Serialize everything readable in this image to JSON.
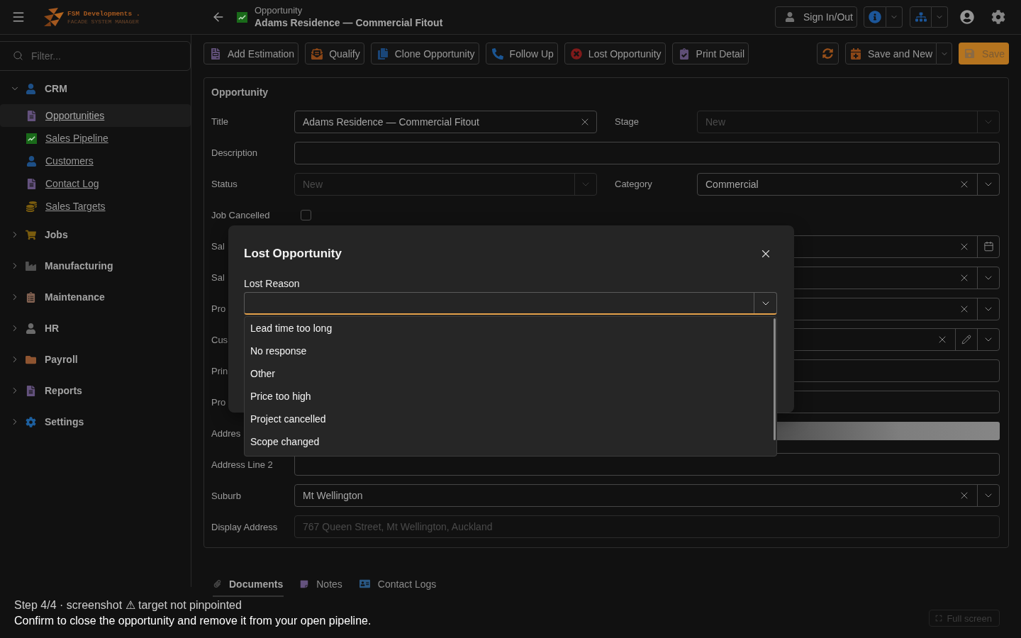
{
  "header": {
    "logo_text": "FSM Developments .",
    "logo_tagline": "FACADE SYSTEM MANAGER",
    "breadcrumb": "Opportunity",
    "title": "Adams Residence — Commercial Fitout",
    "sign_in_button": "Sign In/Out"
  },
  "sidebar": {
    "filter": {
      "placeholder": "Filter..."
    },
    "items": [
      {
        "label": "CRM",
        "expanded": true,
        "children": [
          {
            "label": "Opportunities",
            "selected": true
          },
          {
            "label": "Sales Pipeline",
            "selected": false
          },
          {
            "label": "Customers",
            "selected": false
          },
          {
            "label": "Contact Log",
            "selected": false
          },
          {
            "label": "Sales Targets",
            "selected": false
          }
        ]
      },
      {
        "label": "Jobs",
        "expanded": false
      },
      {
        "label": "Manufacturing",
        "expanded": false
      },
      {
        "label": "Maintenance",
        "expanded": false
      },
      {
        "label": "HR",
        "expanded": false
      },
      {
        "label": "Payroll",
        "expanded": false
      },
      {
        "label": "Reports",
        "expanded": false
      },
      {
        "label": "Settings",
        "expanded": false
      }
    ]
  },
  "toolbar": {
    "actions": [
      "Add Estimation",
      "Qualify",
      "Clone Opportunity",
      "Follow Up",
      "Lost Opportunity",
      "Print Detail"
    ],
    "save_and_new_button": "Save and New",
    "save_button": "Save"
  },
  "form": {
    "heading": "Opportunity",
    "rows": [
      {
        "fields": [
          {
            "label": "Title",
            "kind": "text",
            "value": "Adams Residence — Commercial Fitout",
            "clearable": true,
            "disabled": false
          },
          {
            "label": "Stage",
            "kind": "select",
            "value": "New",
            "clearable": false,
            "disabled": true
          }
        ]
      },
      {
        "fields": [
          {
            "label": "Description",
            "kind": "text",
            "clearable": false,
            "disabled": false
          }
        ]
      },
      {
        "fields": [
          {
            "label": "Status",
            "kind": "select",
            "value": "New",
            "clearable": false,
            "disabled": true
          },
          {
            "label": "Category",
            "kind": "select",
            "value": "Commercial",
            "clearable": true,
            "disabled": false
          }
        ]
      },
      {
        "fields": [
          {
            "label": "Job Cancelled",
            "kind": "checkbox",
            "checked": false
          }
        ]
      },
      {
        "fields": [
          {
            "label": "Sal",
            "kind": "date",
            "clearable": true,
            "disabled": false
          }
        ]
      },
      {
        "fields": [
          {
            "label": "Sal",
            "kind": "select",
            "clearable": true,
            "disabled": false
          }
        ]
      },
      {
        "fields": [
          {
            "label": "Pro",
            "kind": "select",
            "clearable": true,
            "disabled": false
          }
        ]
      },
      {
        "fields": [
          {
            "label": "Cus",
            "kind": "lookup",
            "clearable": true,
            "disabled": false
          }
        ]
      },
      {
        "fields": [
          {
            "label": "Prin",
            "kind": "text",
            "clearable": false,
            "disabled": false
          }
        ]
      },
      {
        "fields": [
          {
            "label": "Pro",
            "kind": "text",
            "clearable": false,
            "disabled": false
          }
        ]
      },
      {
        "fields": [
          {
            "label": "Addres",
            "kind": "loading"
          }
        ]
      },
      {
        "fields": [
          {
            "label": "Address Line 2",
            "kind": "text",
            "clearable": false,
            "disabled": false
          }
        ]
      },
      {
        "fields": [
          {
            "label": "Suburb",
            "kind": "select",
            "value": "Mt Wellington",
            "clearable": true,
            "disabled": false
          }
        ]
      },
      {
        "fields": [
          {
            "label": "Display Address",
            "kind": "text",
            "value": "767 Queen Street, Mt Wellington, Auckland",
            "clearable": false,
            "disabled": true
          }
        ]
      }
    ]
  },
  "tabs": [
    {
      "label": "Documents",
      "selected": true
    },
    {
      "label": "Notes",
      "selected": false
    },
    {
      "label": "Contact Logs",
      "selected": false
    }
  ],
  "full_screen_button": "Full screen",
  "dialog": {
    "title": "Lost Opportunity",
    "field": {
      "label": "Lost Reason",
      "expanded": true,
      "options": [
        {
          "label": "Lead time too long",
          "selected": false
        },
        {
          "label": "No response",
          "selected": false
        },
        {
          "label": "Other",
          "selected": false
        },
        {
          "label": "Price too high",
          "selected": false
        },
        {
          "label": "Project cancelled",
          "selected": false
        },
        {
          "label": "Scope changed",
          "selected": false
        }
      ]
    }
  },
  "caption": {
    "step": "Step 4/4 · screenshot ⚠ target not pinpointed",
    "text": "Confirm to close the opportunity and remove it from your open pipeline."
  }
}
